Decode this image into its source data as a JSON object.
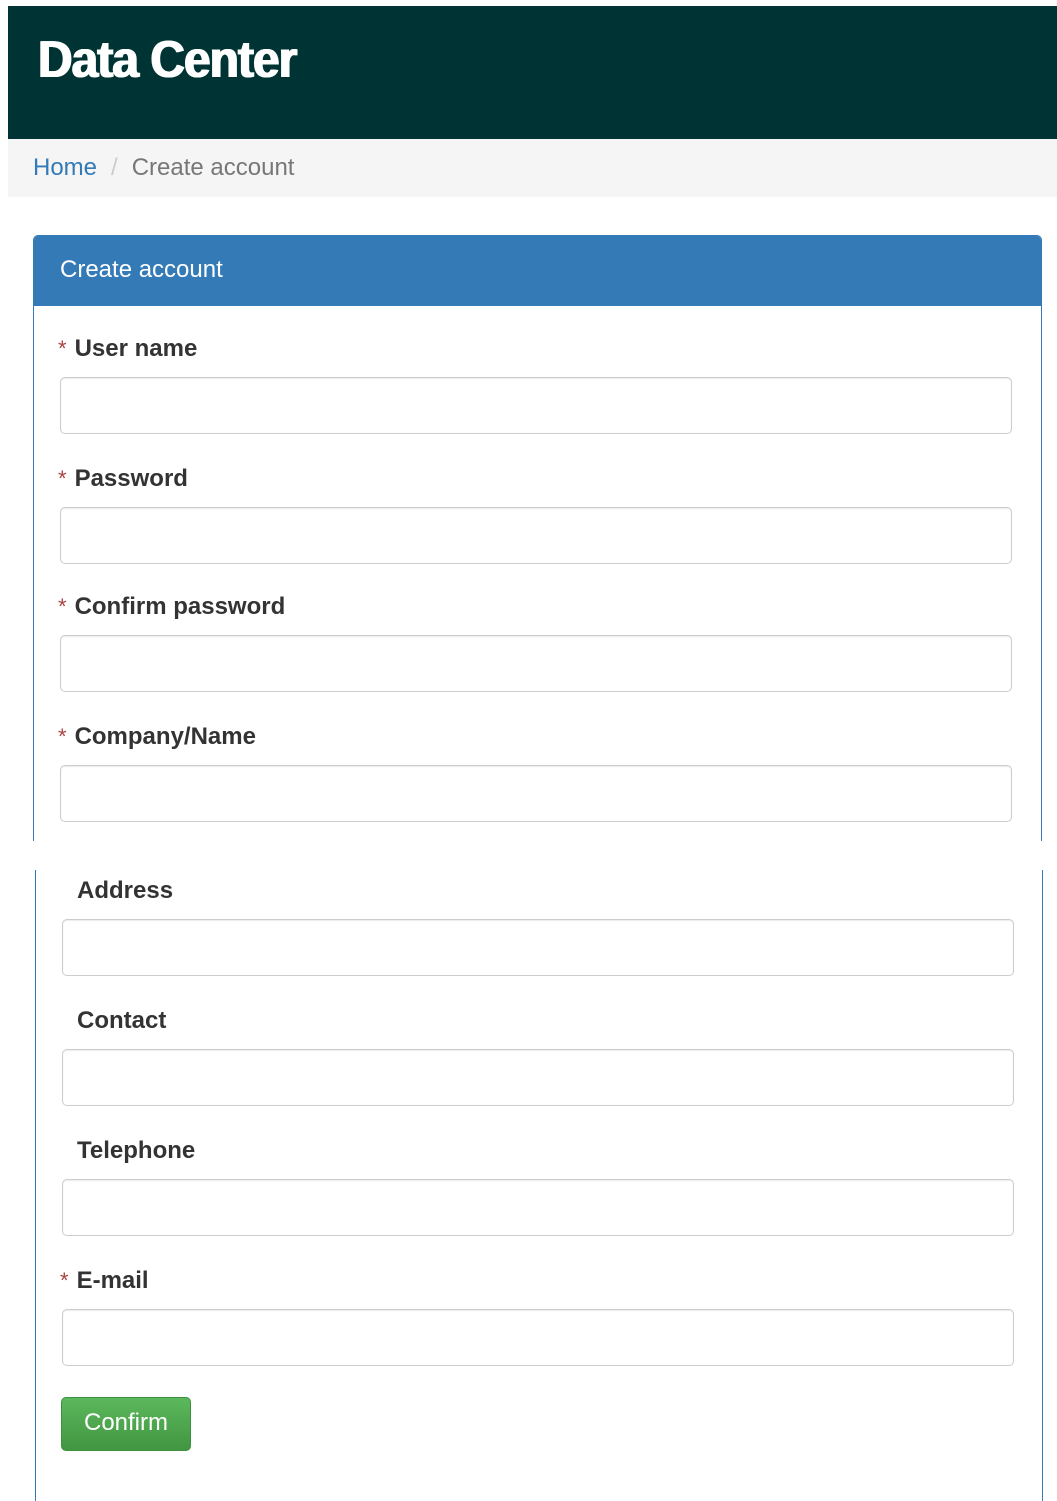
{
  "header": {
    "brand": "Data Center"
  },
  "breadcrumb": {
    "home": "Home",
    "separator": "/",
    "current": "Create account"
  },
  "panel": {
    "title": "Create account"
  },
  "form": {
    "required_marker": "*",
    "fields": [
      {
        "label": "User name",
        "required": true,
        "value": ""
      },
      {
        "label": "Password",
        "required": true,
        "value": ""
      },
      {
        "label": "Confirm password",
        "required": true,
        "value": ""
      },
      {
        "label": "Company/Name",
        "required": true,
        "value": ""
      },
      {
        "label": "Address",
        "required": false,
        "value": ""
      },
      {
        "label": "Contact",
        "required": false,
        "value": ""
      },
      {
        "label": "Telephone",
        "required": false,
        "value": ""
      },
      {
        "label": "E-mail",
        "required": true,
        "value": ""
      }
    ],
    "submit_label": "Confirm"
  },
  "colors": {
    "header_bg": "#003333",
    "primary": "#337ab7",
    "success": "#5cb85c",
    "required": "#a94442"
  }
}
